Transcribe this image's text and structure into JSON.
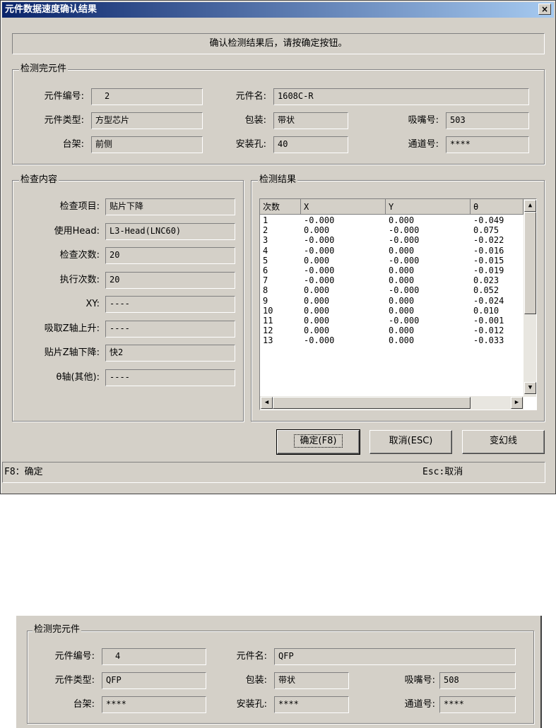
{
  "window": {
    "title": "元件数据速度确认结果",
    "close_label": "×"
  },
  "banner": {
    "text": "确认检测结果后，请按确定按钮。"
  },
  "component_group": {
    "legend": "检测完元件",
    "part_no_label": "元件编号:",
    "part_no": "2",
    "part_name_label": "元件名:",
    "part_name": "1608C-R",
    "part_type_label": "元件类型:",
    "part_type": "方型芯片",
    "package_label": "包装:",
    "package": "带状",
    "nozzle_label": "吸嘴号:",
    "nozzle": "503",
    "stage_label": "台架:",
    "stage": "前侧",
    "hole_label": "安装孔:",
    "hole": "40",
    "channel_label": "通道号:",
    "channel": "****"
  },
  "check_group": {
    "legend": "检查内容",
    "rows": [
      {
        "label": "检查项目:",
        "value": "贴片下降"
      },
      {
        "label": "使用Head:",
        "value": "L3-Head(LNC60)"
      },
      {
        "label": "检查次数:",
        "value": "20"
      },
      {
        "label": "执行次数:",
        "value": "20"
      },
      {
        "label": "XY:",
        "value": "----"
      },
      {
        "label": "吸取Z轴上升:",
        "value": "----"
      },
      {
        "label": "贴片Z轴下降:",
        "value": "快2"
      },
      {
        "label": "θ轴(其他):",
        "value": "----"
      }
    ]
  },
  "results_group": {
    "legend": "检测结果",
    "columns": [
      "次数",
      "X",
      "Y",
      "θ"
    ],
    "rows": [
      [
        "1",
        "-0.000",
        "0.000",
        "-0.049"
      ],
      [
        "2",
        "0.000",
        "-0.000",
        "0.075"
      ],
      [
        "3",
        "-0.000",
        "-0.000",
        "-0.022"
      ],
      [
        "4",
        "-0.000",
        "0.000",
        "-0.016"
      ],
      [
        "5",
        "0.000",
        "-0.000",
        "-0.015"
      ],
      [
        "6",
        "-0.000",
        "0.000",
        "-0.019"
      ],
      [
        "7",
        "-0.000",
        "0.000",
        "0.023"
      ],
      [
        "8",
        "0.000",
        "-0.000",
        "0.052"
      ],
      [
        "9",
        "0.000",
        "0.000",
        "-0.024"
      ],
      [
        "10",
        "0.000",
        "0.000",
        "0.010"
      ],
      [
        "11",
        "0.000",
        "-0.000",
        "-0.001"
      ],
      [
        "12",
        "0.000",
        "0.000",
        "-0.012"
      ],
      [
        "13",
        "-0.000",
        "0.000",
        "-0.033"
      ]
    ]
  },
  "buttons": {
    "ok": "确定(F8)",
    "cancel": "取消(ESC)",
    "phantom": "变幻线"
  },
  "status": {
    "left": "F8：确定",
    "right": "Esc:取消"
  },
  "second_panel": {
    "legend": "检测完元件",
    "part_no_label": "元件编号:",
    "part_no": "4",
    "part_name_label": "元件名:",
    "part_name": "QFP",
    "part_type_label": "元件类型:",
    "part_type": "QFP",
    "package_label": "包装:",
    "package": "带状",
    "nozzle_label": "吸嘴号:",
    "nozzle": "508",
    "stage_label": "台架:",
    "stage": "****",
    "hole_label": "安装孔:",
    "hole": "****",
    "channel_label": "通道号:",
    "channel": "****"
  }
}
